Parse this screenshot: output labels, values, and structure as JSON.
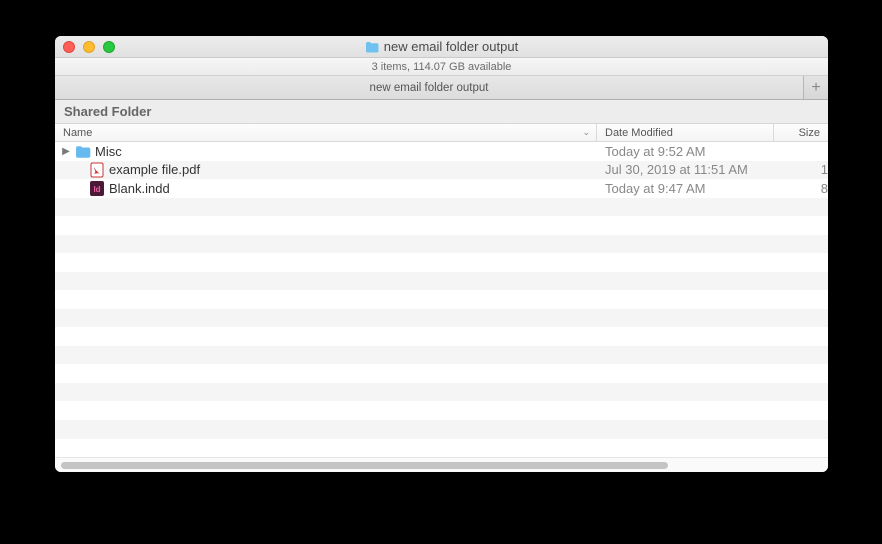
{
  "window": {
    "title": "new email folder output"
  },
  "status": {
    "text": "3 items, 114.07 GB available"
  },
  "tab": {
    "label": "new email folder output",
    "add_glyph": "+"
  },
  "banner": {
    "text": "Shared Folder"
  },
  "columns": {
    "name": "Name",
    "date": "Date Modified",
    "size": "Size"
  },
  "rows": [
    {
      "kind": "folder",
      "name": "Misc",
      "date": "Today at 9:52 AM",
      "size": "",
      "has_children": true
    },
    {
      "kind": "pdf",
      "name": "example file.pdf",
      "date": "Jul 30, 2019 at 11:51 AM",
      "size": "1"
    },
    {
      "kind": "indd",
      "name": "Blank.indd",
      "date": "Today at 9:47 AM",
      "size": "8"
    }
  ]
}
